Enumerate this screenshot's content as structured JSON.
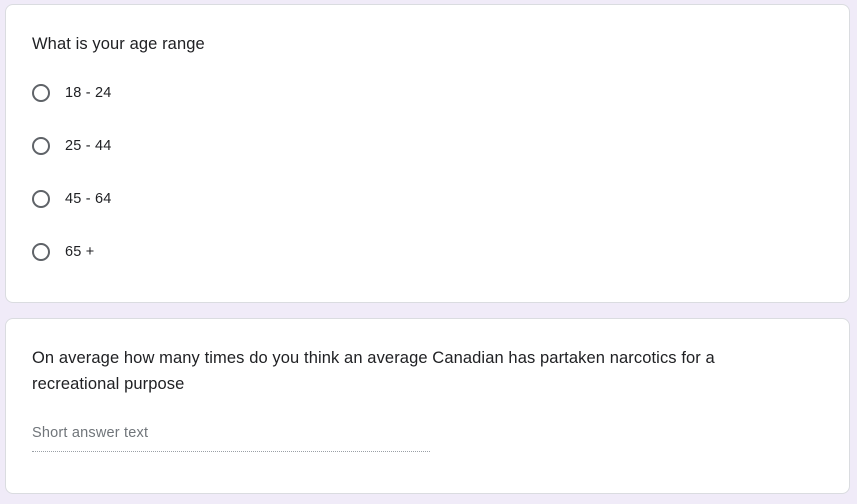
{
  "questions": [
    {
      "title": "What is your age range",
      "type": "multiple_choice",
      "options": [
        {
          "label": "18 - 24",
          "selected": false
        },
        {
          "label": "25 - 44",
          "selected": false
        },
        {
          "label": "45 - 64",
          "selected": false
        },
        {
          "label": "65 +",
          "selected": false
        }
      ]
    },
    {
      "title": "On average how many times do you think an average Canadian has partaken narcotics for a recreational purpose",
      "type": "short_answer",
      "placeholder": "Short answer text",
      "value": ""
    }
  ],
  "colors": {
    "page_background": "#f0ebf8",
    "card_background": "#ffffff",
    "radio_border": "#5f6368",
    "placeholder_text": "#70757a"
  },
  "icons": {
    "radio": "radio-unchecked-icon"
  }
}
